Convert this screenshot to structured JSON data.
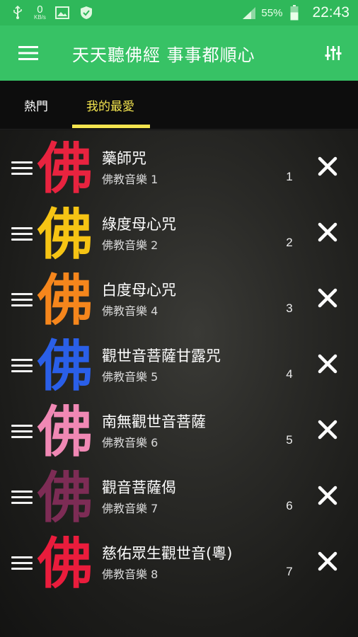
{
  "status_bar": {
    "data_speed_value": "0",
    "data_speed_unit": "KB/s",
    "battery_percent": "55%",
    "time": "22:43",
    "icons": [
      "usb-icon",
      "gallery-icon",
      "shield-icon",
      "signal-icon",
      "battery-icon"
    ]
  },
  "app_bar": {
    "title": "天天聽佛經 事事都順心",
    "menu_icon": "hamburger-menu-icon",
    "settings_icon": "equalizer-settings-icon",
    "color": "#37c265"
  },
  "tabs": [
    {
      "label": "熱門",
      "active": false
    },
    {
      "label": "我的最愛",
      "active": true
    }
  ],
  "accent_color": "#f3e44f",
  "favorites": [
    {
      "glyph": "佛",
      "glyph_color": "#e8233f",
      "title": "藥師咒",
      "subtitle": "佛教音樂 1",
      "index": "1"
    },
    {
      "glyph": "佛",
      "glyph_color": "#f6c414",
      "title": "綠度母心咒",
      "subtitle": "佛教音樂 2",
      "index": "2"
    },
    {
      "glyph": "佛",
      "glyph_color": "#f5861c",
      "title": "白度母心咒",
      "subtitle": "佛教音樂 4",
      "index": "3"
    },
    {
      "glyph": "佛",
      "glyph_color": "#2a5fe8",
      "title": "觀世音菩薩甘露咒",
      "subtitle": "佛教音樂 5",
      "index": "4"
    },
    {
      "glyph": "佛",
      "glyph_color": "#f088b4",
      "title": "南無觀世音菩薩",
      "subtitle": "佛教音樂 6",
      "index": "5"
    },
    {
      "glyph": "佛",
      "glyph_color": "#7d2c55",
      "title": "觀音菩薩偈",
      "subtitle": "佛教音樂 7",
      "index": "6"
    },
    {
      "glyph": "佛",
      "glyph_color": "#ea1c3c",
      "title": "慈佑眾生觀世音(粵)",
      "subtitle": "佛教音樂 8",
      "index": "7"
    }
  ]
}
